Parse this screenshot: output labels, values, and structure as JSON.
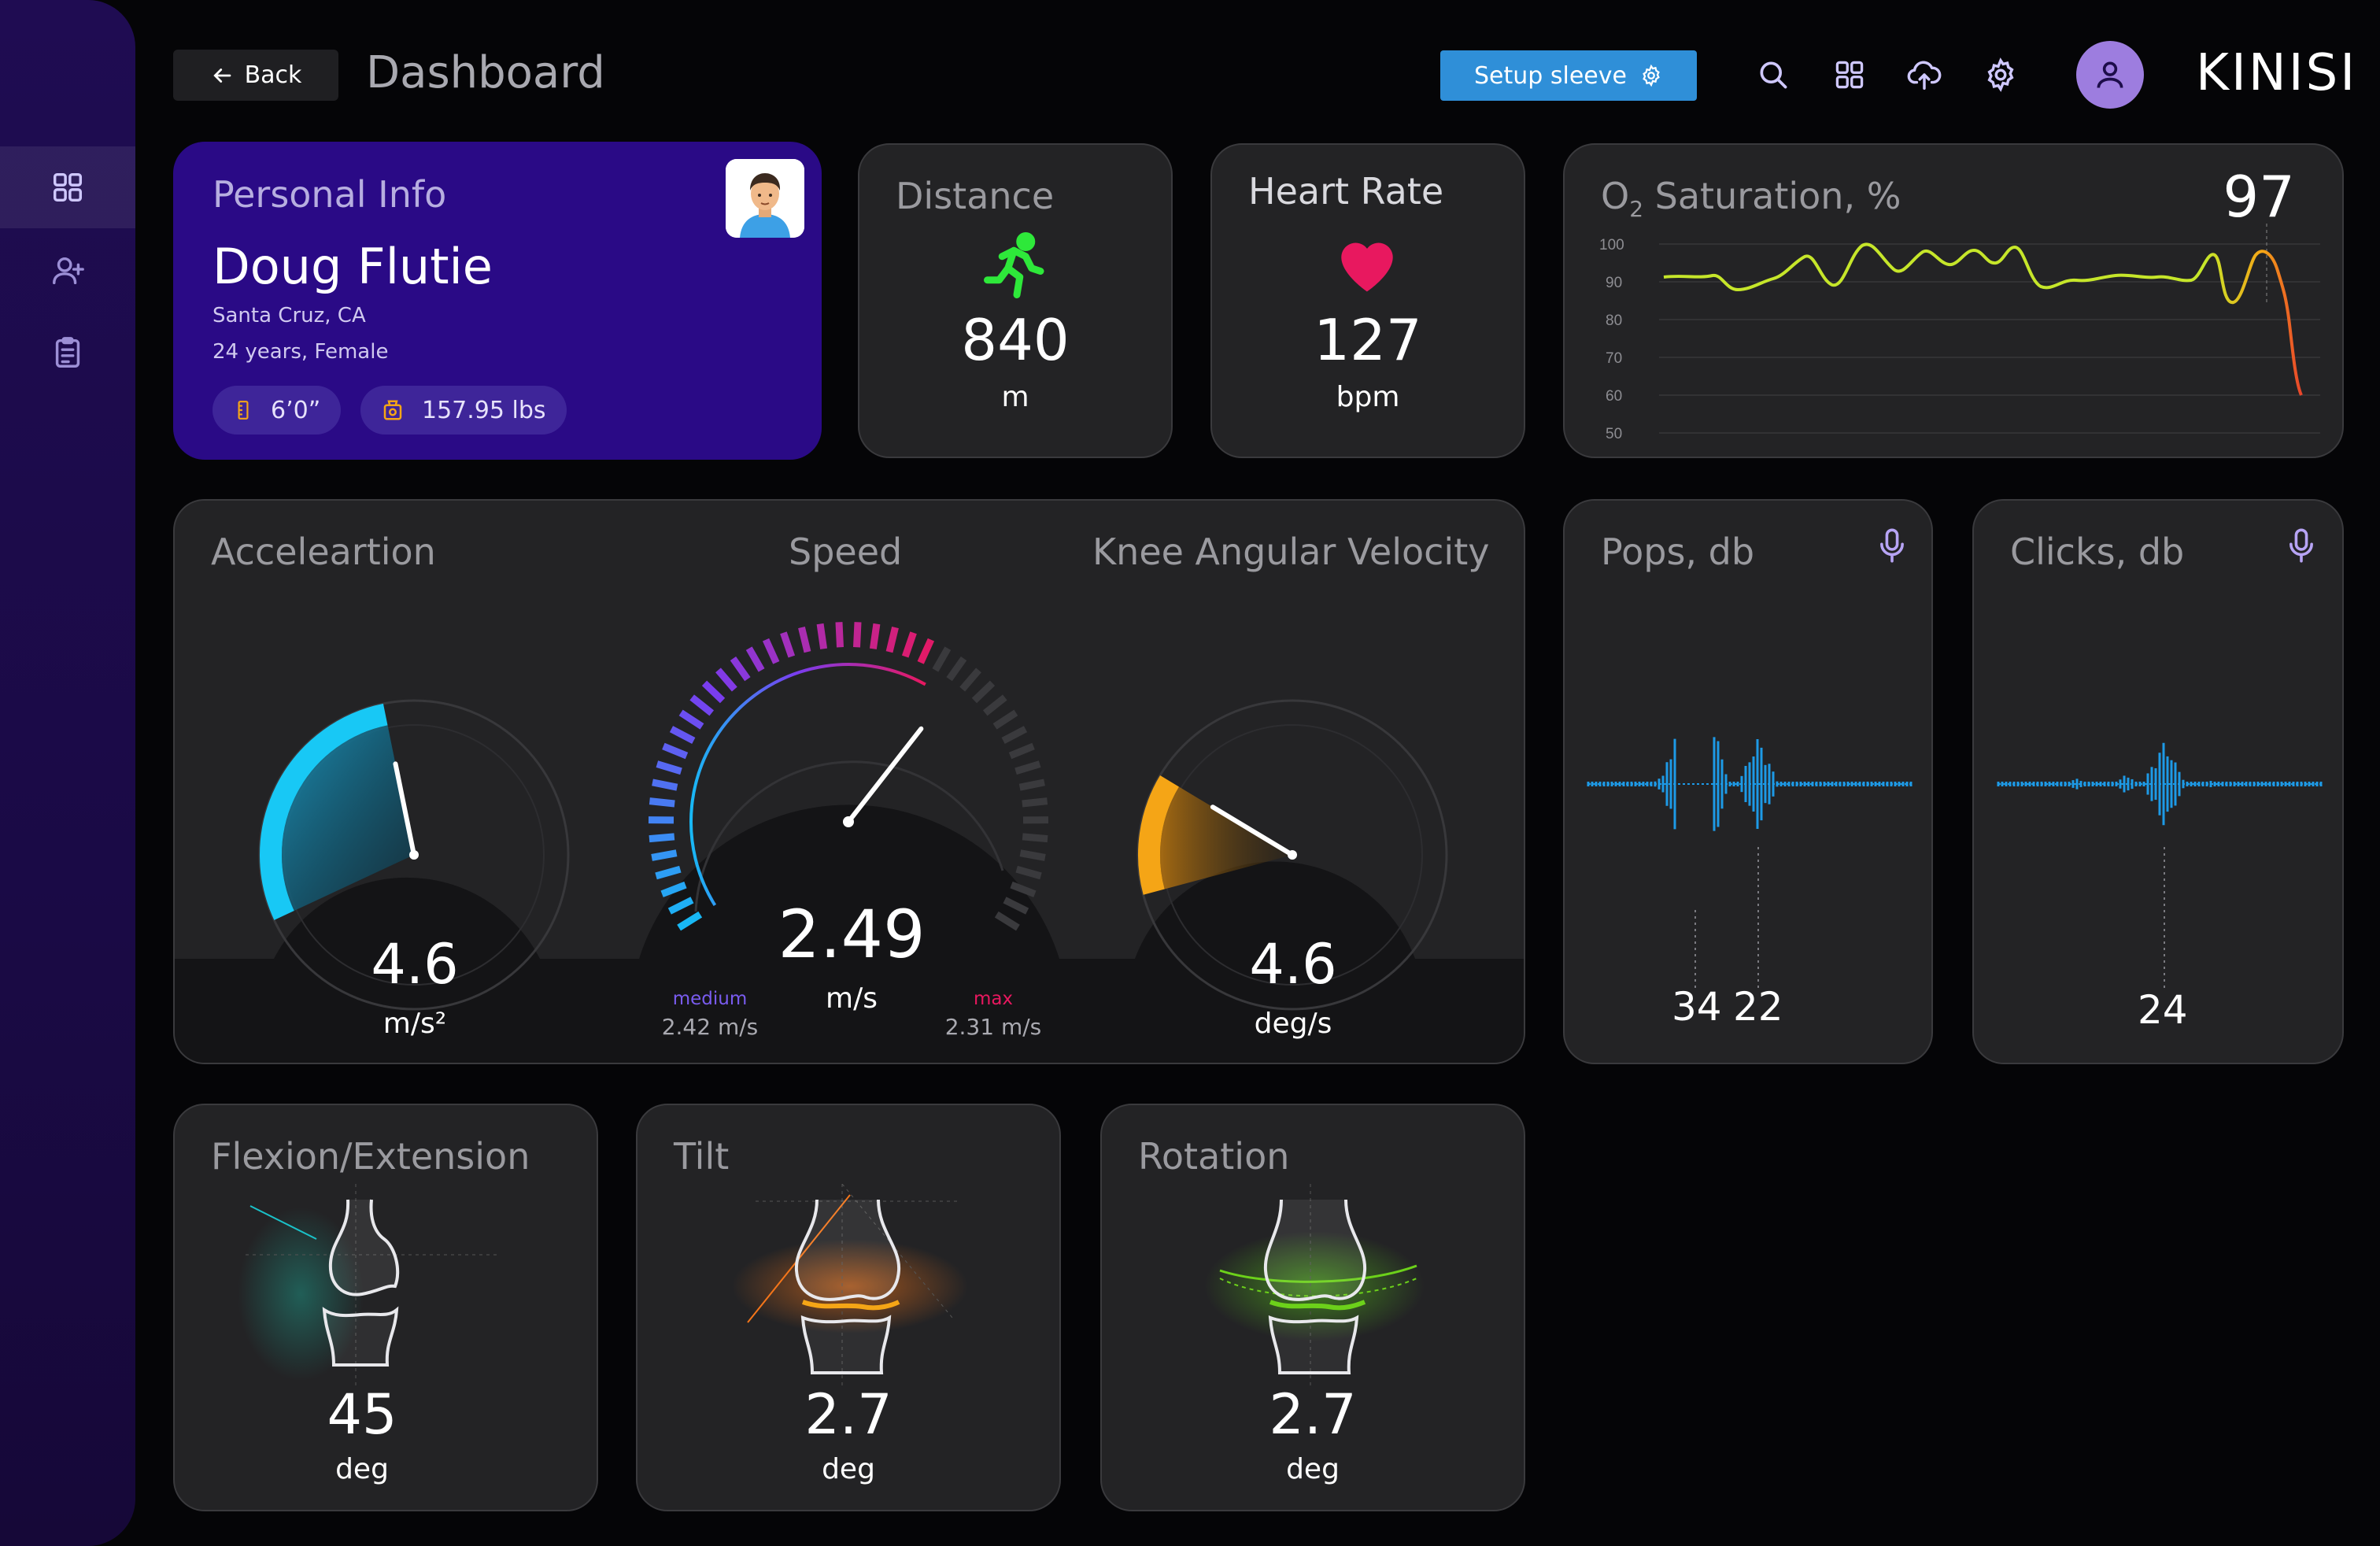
{
  "header": {
    "back_label": "Back",
    "page_title": "Dashboard",
    "setup_label": "Setup sleeve",
    "logo": "KINISI"
  },
  "sidebar": {
    "items": [
      {
        "icon": "grid-icon",
        "active": true
      },
      {
        "icon": "add-user-icon",
        "active": false
      },
      {
        "icon": "clipboard-icon",
        "active": false
      }
    ]
  },
  "personal": {
    "title": "Personal Info",
    "name": "Doug Flutie",
    "location": "Santa Cruz, CA",
    "age_sex": "24 years, Female",
    "height": "6’0”",
    "weight": "157.95 lbs"
  },
  "distance": {
    "title": "Distance",
    "value": "840",
    "unit": "m"
  },
  "heart_rate": {
    "title": "Heart Rate",
    "value": "127",
    "unit": "bpm"
  },
  "o2": {
    "title_pre": "O",
    "title_sub": "2",
    "title_post": " Saturation, %",
    "value": "97",
    "ticks": [
      "100",
      "90",
      "80",
      "70",
      "60",
      "50"
    ]
  },
  "motion": {
    "acceleration": {
      "title": "Acceleartion",
      "value": "4.6",
      "unit": "m/s²",
      "level": 0.45
    },
    "speed": {
      "title": "Speed",
      "value": "2.49",
      "unit": "m/s",
      "medium_label": "medium",
      "medium_value": "2.42 m/s",
      "max_label": "max",
      "max_value": "2.31 m/s",
      "level": 0.62
    },
    "knee": {
      "title": "Knee Angular Velocity",
      "value": "4.6",
      "unit": "deg/s",
      "level": 0.2
    }
  },
  "pops": {
    "title": "Pops, db",
    "values": [
      "34",
      "22"
    ]
  },
  "clicks": {
    "title": "Clicks, db",
    "values": [
      "24"
    ]
  },
  "joints": {
    "flexion": {
      "title": "Flexion/Extension",
      "value": "45",
      "unit": "deg"
    },
    "tilt": {
      "title": "Tilt",
      "value": "2.7",
      "unit": "deg"
    },
    "rotation": {
      "title": "Rotation",
      "value": "2.7",
      "unit": "deg"
    }
  },
  "colors": {
    "accent_purple": "#2a0a86",
    "accel_cyan": "#18c8f5",
    "knee_orange": "#f5a516",
    "heart_pink": "#e8185f",
    "run_green": "#2ee83a"
  }
}
